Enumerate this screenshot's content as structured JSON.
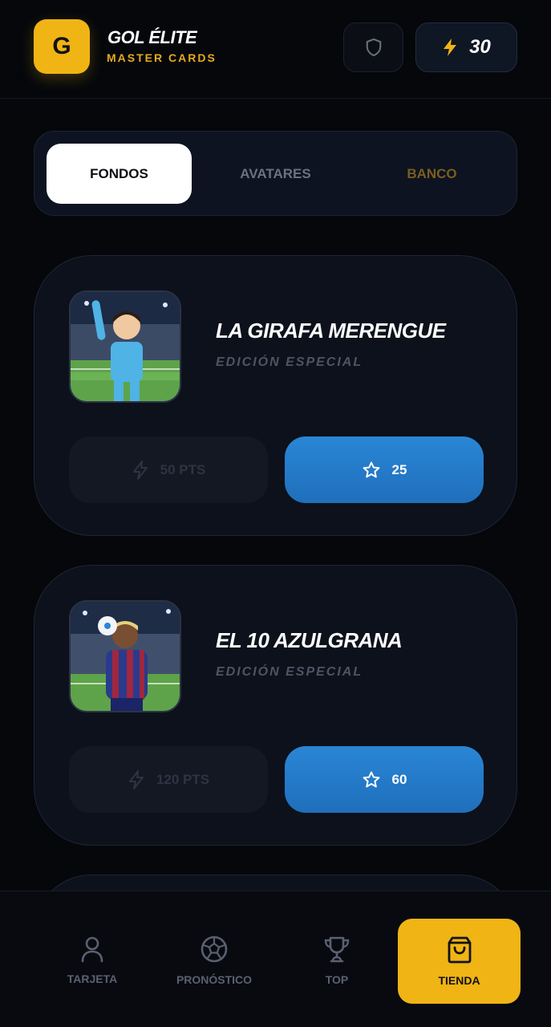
{
  "header": {
    "logo_letter": "G",
    "brand_title": "GOL ÉLITE",
    "brand_subtitle": "MASTER CARDS",
    "points": "30"
  },
  "tabs": [
    {
      "label": "FONDOS",
      "active": true
    },
    {
      "label": "AVATARES",
      "active": false
    },
    {
      "label": "BANCO",
      "active": false
    }
  ],
  "cards": [
    {
      "title": "LA GIRAFA MERENGUE",
      "subtitle": "EDICIÓN ESPECIAL",
      "points_price": "50 PTS",
      "stars_price": "25",
      "kit_color": "#4fb3e6"
    },
    {
      "title": "EL 10 AZULGRANA",
      "subtitle": "EDICIÓN ESPECIAL",
      "points_price": "120 PTS",
      "stars_price": "60",
      "kit_color": "#2a3a8c"
    }
  ],
  "nav": [
    {
      "label": "TARJETA",
      "icon": "user-icon"
    },
    {
      "label": "PRONÓSTICO",
      "icon": "ball-icon"
    },
    {
      "label": "TOP",
      "icon": "trophy-icon"
    },
    {
      "label": "TIENDA",
      "icon": "shopping-bag-icon",
      "active": true
    }
  ],
  "colors": {
    "accent": "#f0b414",
    "blue": "#2a86d6",
    "background": "#05070b"
  }
}
